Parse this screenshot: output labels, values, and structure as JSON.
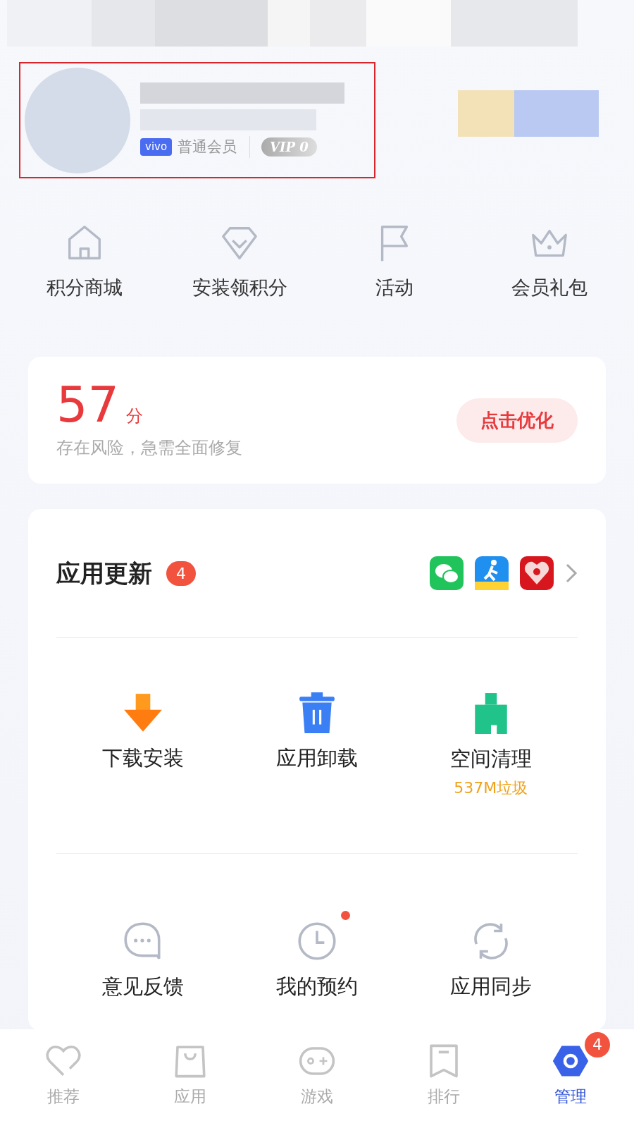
{
  "profile": {
    "badge": "vivo",
    "member_level": "普通会员",
    "vip": "VIP 0",
    "highlighted": true
  },
  "quick_links": [
    {
      "label": "积分商城",
      "kind": "house"
    },
    {
      "label": "安装领积分",
      "kind": "diamond"
    },
    {
      "label": "活动",
      "kind": "flag"
    },
    {
      "label": "会员礼包",
      "kind": "crown"
    }
  ],
  "score": {
    "value": "57",
    "unit": "分",
    "message": "存在风险，急需全面修复",
    "button": "点击优化"
  },
  "updates": {
    "title": "应用更新",
    "count": "4",
    "apps": [
      {
        "kind": "chat"
      },
      {
        "kind": "walk"
      },
      {
        "kind": "red"
      }
    ]
  },
  "tools": [
    {
      "label": "下载安装",
      "kind": "download",
      "dot": false
    },
    {
      "label": "应用卸载",
      "kind": "trash",
      "dot": false
    },
    {
      "label": "空间清理",
      "kind": "broom",
      "dot": false,
      "note": "537M垃圾"
    },
    {
      "label": "意见反馈",
      "kind": "bubble",
      "dot": false
    },
    {
      "label": "我的预约",
      "kind": "clock",
      "dot": true
    },
    {
      "label": "应用同步",
      "kind": "sync",
      "dot": false
    }
  ],
  "nav": [
    {
      "label": "推荐",
      "kind": "heart",
      "selected": false
    },
    {
      "label": "应用",
      "kind": "bag",
      "selected": false
    },
    {
      "label": "游戏",
      "kind": "pad",
      "selected": false
    },
    {
      "label": "排行",
      "kind": "bookmark",
      "selected": false
    },
    {
      "label": "管理",
      "kind": "gear",
      "selected": true,
      "badge": "4"
    }
  ]
}
